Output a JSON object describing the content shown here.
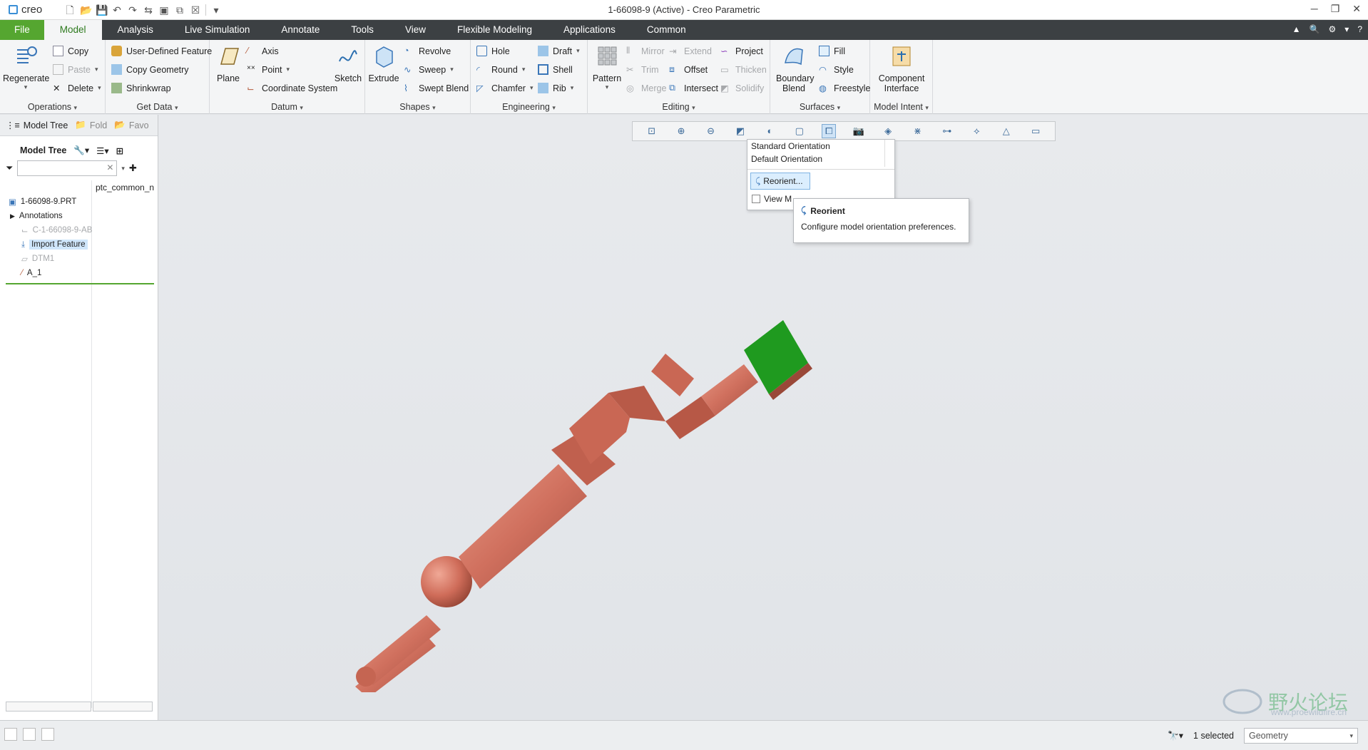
{
  "window": {
    "app_logo": "creo",
    "title": "1-66098-9 (Active) - Creo Parametric"
  },
  "tabs": [
    "File",
    "Model",
    "Analysis",
    "Live Simulation",
    "Annotate",
    "Tools",
    "View",
    "Flexible Modeling",
    "Applications",
    "Common"
  ],
  "ribbon": {
    "operations": {
      "label": "Operations",
      "regenerate": "Regenerate",
      "copy": "Copy",
      "paste": "Paste",
      "delete": "Delete"
    },
    "get_data": {
      "label": "Get Data",
      "udf": "User-Defined Feature",
      "copy_geometry": "Copy Geometry",
      "shrinkwrap": "Shrinkwrap"
    },
    "datum": {
      "label": "Datum",
      "plane": "Plane",
      "axis": "Axis",
      "point": "Point",
      "csys": "Coordinate System",
      "sketch": "Sketch"
    },
    "shapes": {
      "label": "Shapes",
      "extrude": "Extrude",
      "revolve": "Revolve",
      "sweep": "Sweep",
      "swept_blend": "Swept Blend"
    },
    "engineering": {
      "label": "Engineering",
      "hole": "Hole",
      "round": "Round",
      "chamfer": "Chamfer",
      "draft": "Draft",
      "shell": "Shell",
      "rib": "Rib"
    },
    "editing": {
      "label": "Editing",
      "pattern": "Pattern",
      "mirror": "Mirror",
      "trim": "Trim",
      "merge": "Merge",
      "extend": "Extend",
      "offset": "Offset",
      "intersect": "Intersect",
      "project": "Project",
      "thicken": "Thicken",
      "solidify": "Solidify"
    },
    "surfaces": {
      "label": "Surfaces",
      "boundary_blend": "Boundary Blend",
      "fill": "Fill",
      "style": "Style",
      "freestyle": "Freestyle"
    },
    "model_intent": {
      "label": "Model Intent",
      "component_interface": "Component Interface"
    }
  },
  "left_panel": {
    "tabs": [
      "Model Tree",
      "Fold",
      "Favo"
    ],
    "header": "Model Tree",
    "column": "ptc_common_n",
    "tree": [
      {
        "label": "1-66098-9.PRT",
        "state": "normal",
        "icon": "part-icon"
      },
      {
        "label": "Annotations",
        "state": "normal",
        "icon": "expand-arrow-icon"
      },
      {
        "label": "C-1-66098-9-AB",
        "state": "dim",
        "icon": "csys-icon"
      },
      {
        "label": "Import Feature",
        "state": "selected",
        "icon": "import-feature-icon"
      },
      {
        "label": "DTM1",
        "state": "dim",
        "icon": "datum-plane-icon"
      },
      {
        "label": "A_1",
        "state": "normal",
        "icon": "datum-axis-icon"
      }
    ]
  },
  "view_menu": {
    "items": [
      "Standard Orientation",
      "Default Orientation"
    ],
    "reorient": "Reorient...",
    "view_manager": "View M"
  },
  "tooltip": {
    "title": "Reorient",
    "body": "Configure model orientation preferences."
  },
  "status": {
    "selected": "1 selected",
    "filter": "Geometry"
  },
  "watermark": {
    "text": "野火论坛",
    "url": "www.proewildfire.cn"
  },
  "colors": {
    "file_tab": "#55a630",
    "model_copper": "#d0705e",
    "selected_face": "#1f9a1f"
  }
}
